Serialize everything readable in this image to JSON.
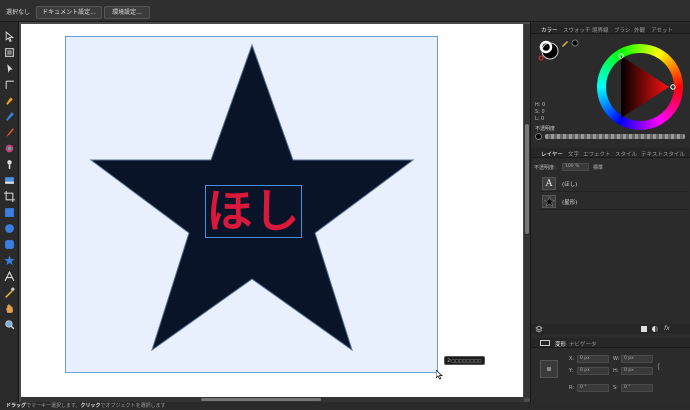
{
  "context_toolbar": {
    "selection_label": "選択なし",
    "document_setup_label": "ドキュメント設定...",
    "preferences_label": "環境設定..."
  },
  "canvas": {
    "text_content": "ほし",
    "text_color": "#d9183b",
    "star_color": "#0a1428",
    "artboard_color": "#e8f0fd",
    "tooltip": "2:□□□□□□□□"
  },
  "status_bar": {
    "drag_label": "ドラッグ",
    "drag_desc": "でマーキー選択します。",
    "click_label": "クリック",
    "click_desc": "でオブジェクトを選択します"
  },
  "color_panel": {
    "tabs": [
      "カラー",
      "スウォッチ",
      "境界線",
      "ブラシ",
      "外観",
      "アセット"
    ],
    "active_tab": "カラー",
    "h_label": "H: 0",
    "s_label": "S: 0",
    "l_label": "L: 0",
    "opacity_label": "不透明度"
  },
  "layers_panel": {
    "tabs": [
      "レイヤー",
      "文字",
      "エフェクト",
      "スタイル",
      "テキストスタイル"
    ],
    "active_tab": "レイヤー",
    "opacity_label": "不透明度:",
    "opacity_value": "100 %",
    "blend_mode": "標準",
    "layers": [
      {
        "name": "(ほし)",
        "icon": "text-layer-icon"
      },
      {
        "name": "(星形)",
        "icon": "star-layer-icon"
      }
    ]
  },
  "transform_panel": {
    "tabs": [
      "変形",
      "ナビゲータ"
    ],
    "active_tab": "変形",
    "x_label": "X:",
    "x_value": "0 px",
    "y_label": "Y:",
    "y_value": "0 px",
    "w_label": "W:",
    "w_value": "0 px",
    "h_label": "H:",
    "h_value": "0 px",
    "r_label": "R:",
    "r_value": "0 °",
    "s_label": "S:",
    "s_value": "0 °"
  }
}
